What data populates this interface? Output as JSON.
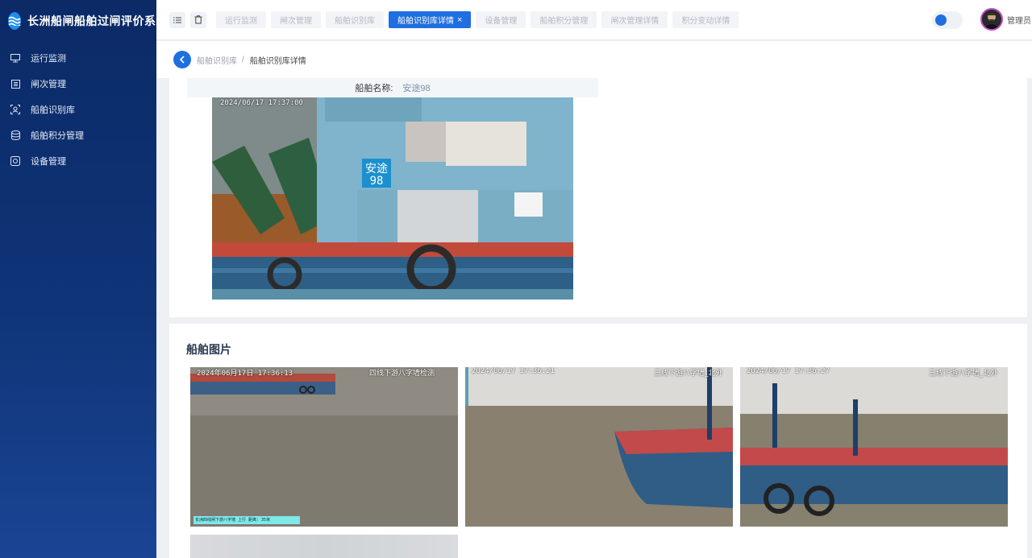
{
  "app": {
    "title": "长洲船闸船舶过闸评价系统"
  },
  "sidebar": {
    "items": [
      {
        "label": "运行监测",
        "icon": "monitor-icon"
      },
      {
        "label": "闸次管理",
        "icon": "list-icon"
      },
      {
        "label": "船舶识别库",
        "icon": "face-scan-icon"
      },
      {
        "label": "船舶积分管理",
        "icon": "database-icon"
      },
      {
        "label": "设备管理",
        "icon": "device-icon"
      }
    ]
  },
  "header": {
    "tabs": [
      {
        "label": "运行监测",
        "active": false
      },
      {
        "label": "闸次管理",
        "active": false
      },
      {
        "label": "船舶识别库",
        "active": false
      },
      {
        "label": "船舶识别库详情",
        "active": true,
        "close": "×"
      },
      {
        "label": "设备管理",
        "active": false
      },
      {
        "label": "船舶积分管理",
        "active": false
      },
      {
        "label": "闸次管理详情",
        "active": false
      },
      {
        "label": "积分变动详情",
        "active": false
      }
    ],
    "user": "管理员"
  },
  "breadcrumb": {
    "parent": "船舶识别库",
    "separator": "/",
    "current": "船舶识别库详情"
  },
  "detail": {
    "name_label": "船舶名称:",
    "name_value": "安途98",
    "photo_timestamp": "2024/06/17 17:37:00",
    "hull_text_1": "安途",
    "hull_text_2": "98"
  },
  "gallery": {
    "title": "船舶图片",
    "images": [
      {
        "timestamp": "2024年06月17日 17:36:13",
        "camera": "四线下游八字墙检测",
        "caption": "长洲四线闸下游八字墙 上行 距离: 35米"
      },
      {
        "timestamp": "2024/06/17 17:36:21",
        "camera": "三线下游八字墙_北外"
      },
      {
        "timestamp": "2024/06/17 17:36:27",
        "camera": "三线下游八字墙_北外"
      }
    ]
  },
  "colors": {
    "primary": "#1f6fe0",
    "sidebar": "#0f3478"
  }
}
